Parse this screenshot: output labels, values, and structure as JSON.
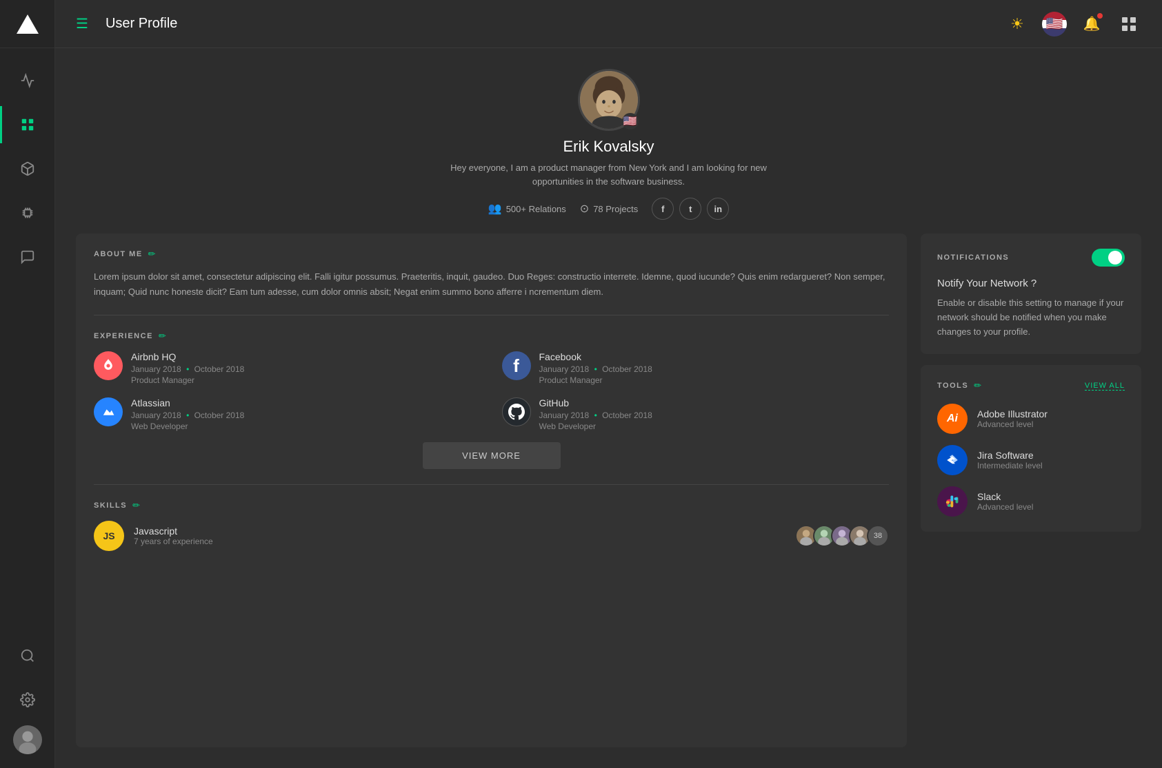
{
  "app": {
    "title": "User Profile"
  },
  "sidebar": {
    "logo_label": "App Logo",
    "items": [
      {
        "id": "activity",
        "icon": "activity",
        "label": "Activity",
        "active": false
      },
      {
        "id": "dashboard",
        "icon": "dashboard",
        "label": "Dashboard",
        "active": true
      },
      {
        "id": "cube",
        "icon": "cube",
        "label": "3D / Box",
        "active": false
      },
      {
        "id": "chip",
        "icon": "chip",
        "label": "Components",
        "active": false
      },
      {
        "id": "chat",
        "icon": "chat",
        "label": "Messages",
        "active": false
      }
    ],
    "bottom_items": [
      {
        "id": "search",
        "icon": "search",
        "label": "Search"
      },
      {
        "id": "settings",
        "icon": "settings",
        "label": "Settings"
      }
    ]
  },
  "header": {
    "menu_icon_label": "Menu",
    "title": "User Profile",
    "sun_icon_label": "Theme Toggle",
    "flag_icon_label": "Language Flag",
    "notification_icon_label": "Notifications",
    "grid_icon_label": "Apps Grid"
  },
  "profile": {
    "name": "Erik Kovalsky",
    "bio": "Hey everyone, I am a product manager from New York and I am looking for new opportunities in the software business.",
    "relations": "500+ Relations",
    "projects": "78 Projects",
    "flag_emoji": "🇺🇸",
    "social": {
      "facebook_label": "f",
      "twitter_label": "t",
      "linkedin_label": "in"
    }
  },
  "about": {
    "section_title": "ABOUT ME",
    "text": "Lorem ipsum dolor sit amet, consectetur adipiscing elit. Falli igitur possumus. Praeteritis, inquit, gaudeo. Duo Reges: constructio interrete. Idemne, quod iucunde? Quis enim redargueret? Non semper, inquam; Quid nunc honeste dicit? Eam tum adesse, cum dolor omnis absit; Negat enim summo bono afferre i ncrementum diem."
  },
  "experience": {
    "section_title": "EXPERIENCE",
    "items": [
      {
        "company": "Airbnb HQ",
        "logo_type": "airbnb",
        "logo_label": "Airbnb Logo",
        "date_start": "January 2018",
        "date_end": "October 2018",
        "role": "Product Manager"
      },
      {
        "company": "Facebook",
        "logo_type": "facebook",
        "logo_label": "Facebook Logo",
        "date_start": "January 2018",
        "date_end": "October 2018",
        "role": "Product Manager"
      },
      {
        "company": "Atlassian",
        "logo_type": "atlassian",
        "logo_label": "Atlassian Logo",
        "date_start": "January 2018",
        "date_end": "October 2018",
        "role": "Web Developer"
      },
      {
        "company": "GitHub",
        "logo_type": "github",
        "logo_label": "GitHub Logo",
        "date_start": "January 2018",
        "date_end": "October 2018",
        "role": "Web Developer"
      }
    ],
    "view_more_label": "VIEW MORE"
  },
  "skills": {
    "section_title": "SKILLS",
    "items": [
      {
        "name": "Javascript",
        "experience": "7 years of experience",
        "badge_text": "JS",
        "endorser_count": "38"
      }
    ]
  },
  "notifications": {
    "section_title": "NOTIFICATIONS",
    "toggle_on": true,
    "heading": "Notify Your Network ?",
    "description": "Enable or disable this setting to manage if your network should be notified when you make changes to your profile."
  },
  "tools": {
    "section_title": "TOOLS",
    "view_all_label": "VIEW ALL",
    "items": [
      {
        "name": "Adobe Illustrator",
        "level": "Advanced level",
        "logo_type": "ai",
        "logo_label": "Adobe Illustrator Logo",
        "logo_text": "Ai"
      },
      {
        "name": "Jira Software",
        "level": "Intermediate level",
        "logo_type": "jira",
        "logo_label": "Jira Software Logo",
        "logo_text": "◆"
      },
      {
        "name": "Slack",
        "level": "Advanced level",
        "logo_type": "slack",
        "logo_label": "Slack Logo",
        "logo_text": "#"
      }
    ]
  }
}
